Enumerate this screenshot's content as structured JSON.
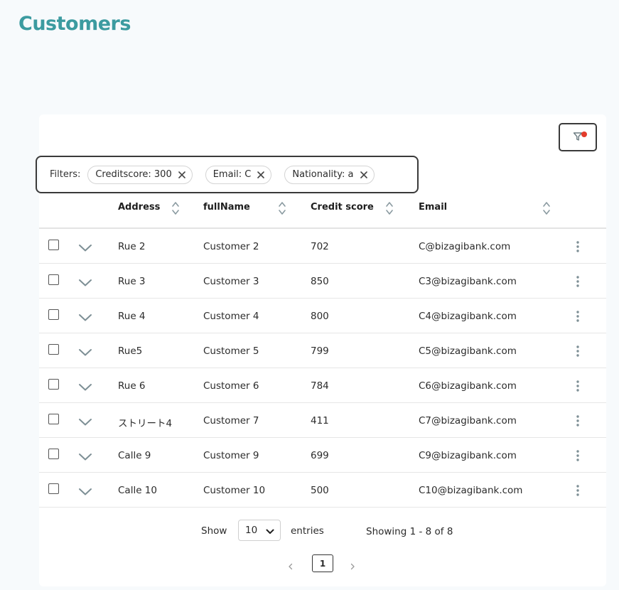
{
  "page": {
    "title": "Customers"
  },
  "filters": {
    "label": "Filters:",
    "chips": [
      {
        "label": "Creditscore: 300"
      },
      {
        "label": "Email: C"
      },
      {
        "label": "Nationality: a"
      }
    ]
  },
  "table": {
    "columns": [
      {
        "label": "Address"
      },
      {
        "label": "fullName"
      },
      {
        "label": "Credit score"
      },
      {
        "label": "Email"
      }
    ],
    "rows": [
      {
        "address": "Rue 2",
        "fullName": "Customer 2",
        "credit_score": "702",
        "email": "C@bizagibank.com"
      },
      {
        "address": "Rue 3",
        "fullName": "Customer 3",
        "credit_score": "850",
        "email": "C3@bizagibank.com"
      },
      {
        "address": "Rue 4",
        "fullName": "Customer 4",
        "credit_score": "800",
        "email": "C4@bizagibank.com"
      },
      {
        "address": "Rue5",
        "fullName": "Customer 5",
        "credit_score": "799",
        "email": "C5@bizagibank.com"
      },
      {
        "address": "Rue 6",
        "fullName": "Customer 6",
        "credit_score": "784",
        "email": "C6@bizagibank.com"
      },
      {
        "address": "ストリート4",
        "fullName": "Customer 7",
        "credit_score": "411",
        "email": "C7@bizagibank.com"
      },
      {
        "address": "Calle 9",
        "fullName": "Customer 9",
        "credit_score": "699",
        "email": "C9@bizagibank.com"
      },
      {
        "address": "Calle 10",
        "fullName": "Customer 10",
        "credit_score": "500",
        "email": "C10@bizagibank.com"
      }
    ]
  },
  "footer": {
    "show_label": "Show",
    "entries_value": "10",
    "entries_label": "entries",
    "showing_text": "Showing 1 - 8 of 8"
  },
  "pagination": {
    "current_page": "1",
    "prev_glyph": "‹",
    "next_glyph": "›"
  },
  "icons": {
    "filter": "filter-icon",
    "chip_close": "close-icon",
    "sort": "sort-icon",
    "expand": "chevron-down-icon",
    "row_menu": "kebab-menu-icon"
  },
  "colors": {
    "title": "#3c9ba0",
    "filter_active_dot": "#e33b2b"
  }
}
